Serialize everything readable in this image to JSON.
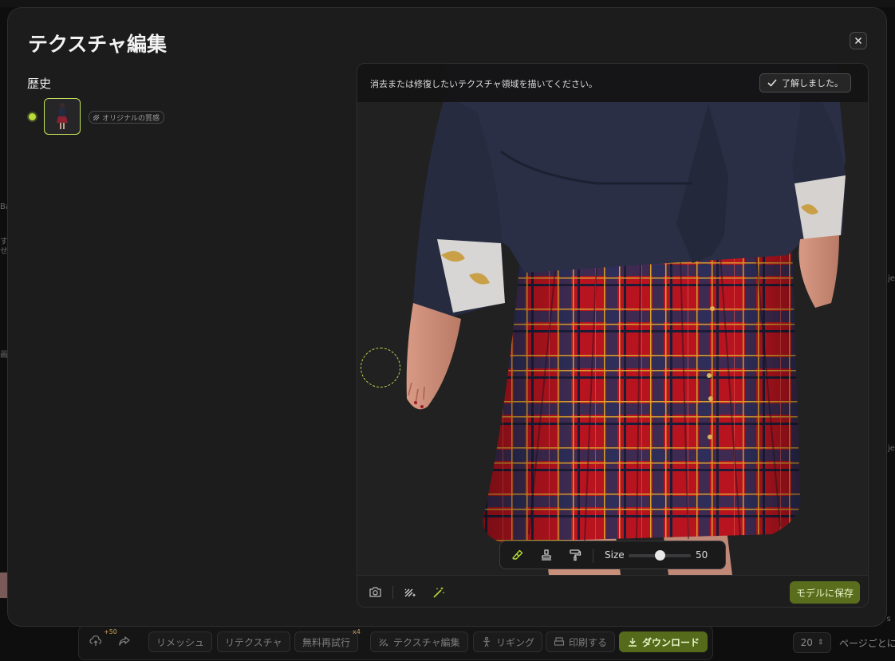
{
  "modal": {
    "title": "テクスチャ編集",
    "history_label": "歴史",
    "history_tag": "オリジナルの質感"
  },
  "viewport": {
    "hint": "消去または修復したいテクスチャ領域を描いてください。",
    "ack_label": "了解しました。",
    "tools": [
      "eraser-icon",
      "stamp-icon",
      "paint-roller-icon"
    ],
    "size_label": "Size",
    "size_value": "50",
    "size_fraction": 0.5,
    "footer_icons": [
      "camera-icon",
      "texture-wand-icon",
      "magic-wand-icon"
    ],
    "save_label": "モデルに保存"
  },
  "bottombar": {
    "upload_badge": "+50",
    "buttons": [
      "リメッシュ",
      "リテクスチャ",
      "無料再試行",
      "テクスチャ編集",
      "リギング",
      "印刷する",
      "ダウンロード"
    ],
    "retry_badge": "x4",
    "page_size": "20",
    "page_label": "ページごとに"
  },
  "background": {
    "fragments": [
      "Ba",
      "す",
      "せ",
      "画",
      "je",
      "je",
      "n s"
    ]
  },
  "colors": {
    "accent": "#b6dd38",
    "save_button": "#5a6d1d",
    "modal_bg": "#1c1c1d"
  }
}
